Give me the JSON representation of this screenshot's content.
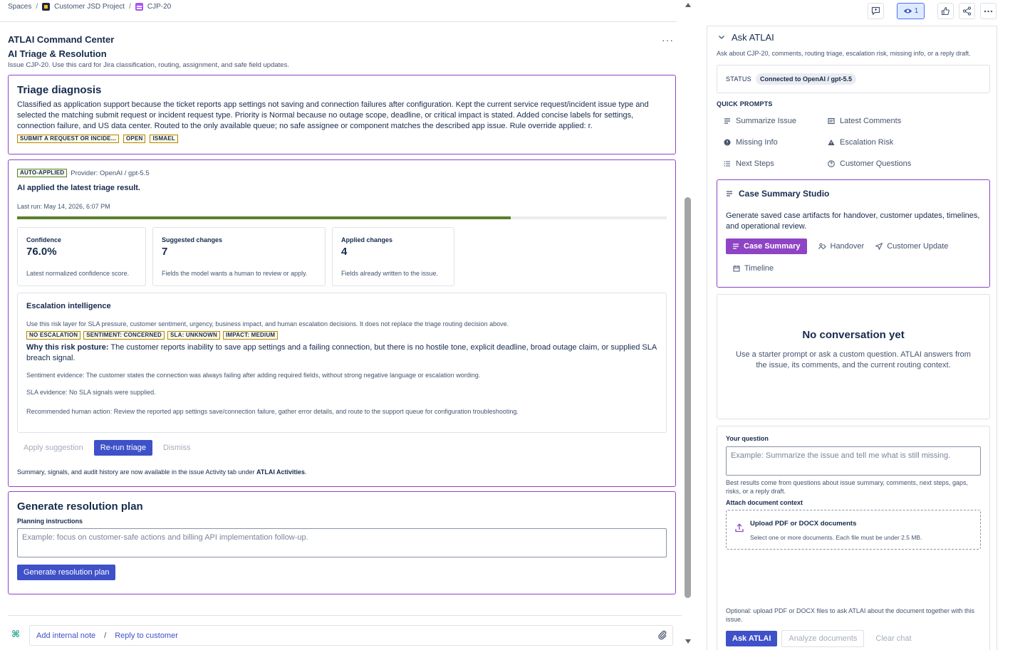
{
  "breadcrumb": {
    "spaces": "Spaces",
    "project": "Customer JSD Project",
    "issue": "CJP-20"
  },
  "header": {
    "title": "ATLAI Command Center",
    "subtitle": "AI Triage & Resolution",
    "description": "Issue CJP-20. Use this card for Jira classification, routing, assignment, and safe field updates.",
    "more": "···"
  },
  "triage": {
    "title": "Triage diagnosis",
    "body": "Classified as application support because the ticket reports app settings not saving and connection failures after configuration. Kept the current service request/incident issue type and selected the matching submit request or incident request type. Priority is Normal because no outage scope, deadline, or critical impact is stated. Added concise labels for settings, connection failure, and US data center. Routed to the only available queue; no safe assignee or component matches the described app issue. Rule override applied: r.",
    "tags": [
      "SUBMIT A REQUEST OR INCIDE...",
      "OPEN",
      "ISMAEL"
    ]
  },
  "auto": {
    "badge": "AUTO-APPLIED",
    "provider": "Provider: OpenAI / gpt-5.5",
    "applied_text": "AI applied the latest triage result.",
    "last_run": "Last run: May 14, 2026, 6:07 PM",
    "progress": 0.76,
    "progress_color": "#5b7f2b",
    "metrics": [
      {
        "label": "Confidence",
        "value": "76.0%",
        "desc": "Latest normalized confidence score."
      },
      {
        "label": "Suggested changes",
        "value": "7",
        "desc": "Fields the model wants a human to review or apply."
      },
      {
        "label": "Applied changes",
        "value": "4",
        "desc": "Fields already written to the issue."
      }
    ],
    "escalation": {
      "title": "Escalation intelligence",
      "desc": "Use this risk layer for SLA pressure, customer sentiment, urgency, business impact, and human escalation decisions. It does not replace the triage routing decision above.",
      "tags": [
        "NO ESCALATION",
        "SENTIMENT: CONCERNED",
        "SLA: UNKNOWN",
        "IMPACT: MEDIUM"
      ],
      "why_label": "Why this risk posture:",
      "why_text": " The customer reports inability to save app settings and a failing connection, but there is no hostile tone, explicit deadline, broad outage claim, or supplied SLA breach signal.",
      "sentiment": "Sentiment evidence: The customer states the connection was always failing after adding required fields, without strong negative language or escalation wording.",
      "sla": "SLA evidence: No SLA signals were supplied.",
      "action": "Recommended human action: Review the reported app settings save/connection failure, gather error details, and route to the support queue for configuration troubleshooting."
    },
    "buttons": {
      "apply": "Apply suggestion",
      "rerun": "Re-run triage",
      "dismiss": "Dismiss"
    },
    "note_prefix": "Summary, signals, and audit history are now available in the issue Activity tab under ",
    "note_bold": "ATLAI Activities",
    "note_suffix": "."
  },
  "resolution": {
    "title": "Generate resolution plan",
    "instructions_label": "Planning instructions",
    "placeholder": "Example: focus on customer-safe actions and billing API implementation follow-up.",
    "button": "Generate resolution plan"
  },
  "compose": {
    "internal_note": "Add internal note",
    "slash": "/",
    "reply": "Reply to customer"
  },
  "toolbar": {
    "watch_count": "1"
  },
  "ask": {
    "title": "Ask ATLAI",
    "desc": "Ask about CJP-20, comments, routing triage, escalation risk, missing info, or a reply draft.",
    "status_label": "STATUS",
    "status_value": "Connected to OpenAI / gpt-5.5",
    "quick_prompts_title": "QUICK PROMPTS",
    "quick_prompts": [
      "Summarize Issue",
      "Latest Comments",
      "Missing Info",
      "Escalation Risk",
      "Next Steps",
      "Customer Questions"
    ],
    "studio": {
      "title": "Case Summary Studio",
      "desc": "Generate saved case artifacts for handover, customer updates, timelines, and operational review.",
      "options": [
        "Case Summary",
        "Handover",
        "Customer Update",
        "Timeline"
      ]
    },
    "no_conv": {
      "title": "No conversation yet",
      "text": "Use a starter prompt or ask a custom question. ATLAI answers from the issue, its comments, and the current routing context."
    },
    "question": {
      "label": "Your question",
      "placeholder": "Example: Summarize the issue and tell me what is still missing.",
      "hint": "Best results come from questions about issue summary, comments, next steps, gaps, risks, or a reply draft.",
      "attach_label": "Attach document context",
      "upload_title": "Upload PDF or DOCX documents",
      "upload_sub": "Select one or more documents. Each file must be under 2.5 MB.",
      "optional": "Optional: upload PDF or DOCX files to ask ATLAI about the document together with this issue.",
      "ask_button": "Ask ATLAI",
      "analyze_button": "Analyze documents",
      "clear_button": "Clear chat"
    }
  }
}
